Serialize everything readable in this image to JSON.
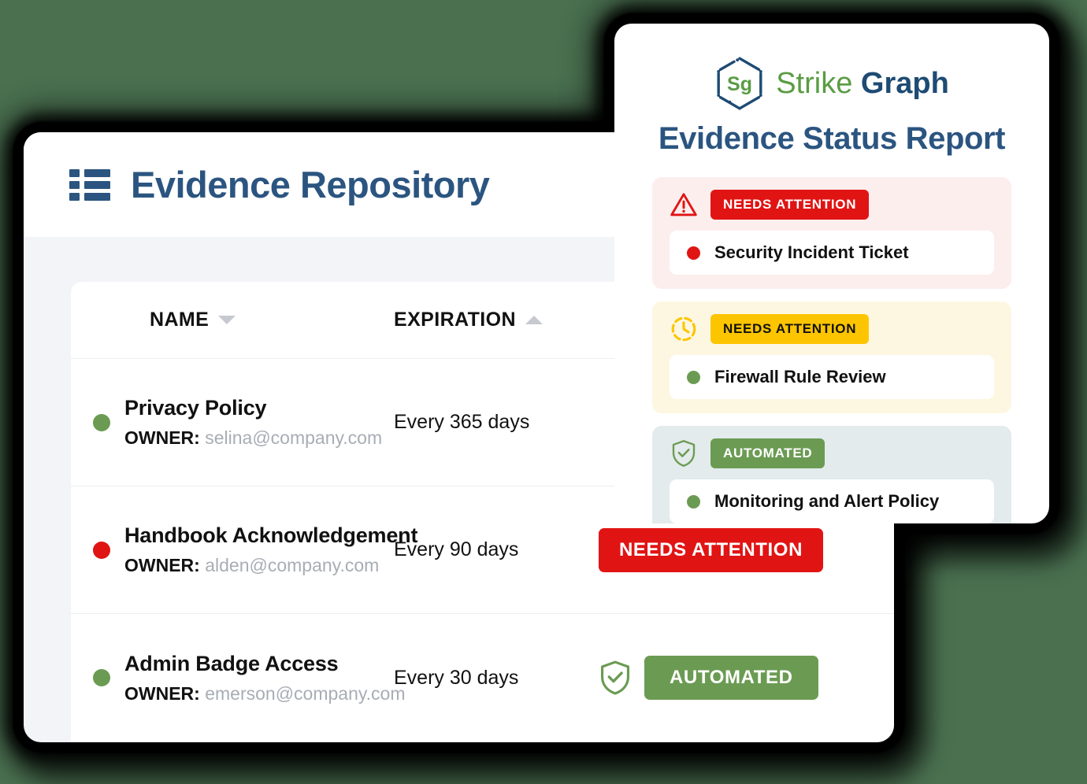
{
  "repository": {
    "title": "Evidence Repository",
    "icon": "list-icon",
    "columns": [
      {
        "label": "NAME",
        "sort": "down"
      },
      {
        "label": "EXPIRATION",
        "sort": "up"
      }
    ],
    "owner_label": "OWNER:",
    "rows": [
      {
        "dot_color": "#6b9b53",
        "name": "Privacy Policy",
        "owner_email": "selina@company.com",
        "expiration": "Every 365 days",
        "status": "",
        "status_type": "none"
      },
      {
        "dot_color": "#e11414",
        "name": "Handbook Acknowledgement",
        "owner_email": "alden@company.com",
        "expiration": "Every 90 days",
        "status": "NEEDS ATTENTION",
        "status_type": "needs-attention"
      },
      {
        "dot_color": "#6b9b53",
        "name": "Admin Badge Access",
        "owner_email": "emerson@company.com",
        "expiration": "Every 30 days",
        "status": "AUTOMATED",
        "status_type": "automated"
      }
    ]
  },
  "report": {
    "brand": {
      "mark": "hexagon-sg-logo",
      "word_one": "Strike",
      "word_two": "Graph"
    },
    "title": "Evidence Status Report",
    "cards": [
      {
        "icon": "warning-triangle-icon",
        "badge": "NEEDS ATTENTION",
        "badge_style": "red",
        "item_dot": "#e11414",
        "item_label": "Security Incident Ticket"
      },
      {
        "icon": "clock-icon",
        "badge": "NEEDS ATTENTION",
        "badge_style": "yellow",
        "item_dot": "#6b9b53",
        "item_label": "Firewall Rule Review"
      },
      {
        "icon": "shield-check-icon",
        "badge": "AUTOMATED",
        "badge_style": "green",
        "item_dot": "#6b9b53",
        "item_label": "Monitoring and Alert Policy"
      }
    ]
  },
  "colors": {
    "background": "#4a7050",
    "brand_blue": "#2b5580",
    "brand_green": "#5a9c44",
    "alert_red": "#e11414",
    "warn_yellow": "#fdc500",
    "ok_green": "#6b9b53"
  }
}
